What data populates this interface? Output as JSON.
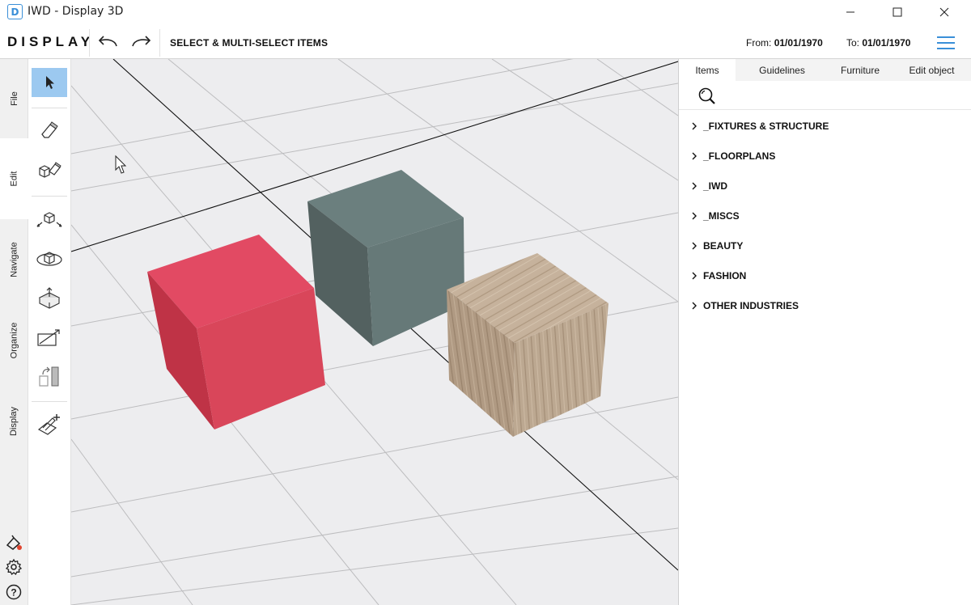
{
  "window": {
    "app_icon_letter": "D",
    "title": "IWD - Display 3D"
  },
  "toolbar": {
    "logo": "DISPLAY",
    "mode_label": "SELECT & MULTI-SELECT ITEMS",
    "from_label": "From:",
    "from_value": "01/01/1970",
    "to_label": "To:",
    "to_value": "01/01/1970"
  },
  "side_tabs": [
    "File",
    "Edit",
    "Navigate",
    "Organize",
    "Display"
  ],
  "tools": [
    {
      "name": "select-arrow-icon",
      "active": true
    },
    {
      "name": "eraser-icon"
    },
    {
      "name": "multi-erase-icon"
    },
    {
      "name": "pan-cube-icon"
    },
    {
      "name": "orbit-cube-icon"
    },
    {
      "name": "lift-cube-icon"
    },
    {
      "name": "resize-frame-icon"
    },
    {
      "name": "align-rotate-icon"
    },
    {
      "name": "add-measure-icon"
    }
  ],
  "viewport": {
    "objects": [
      {
        "name": "red-cube",
        "color": "#e24a63"
      },
      {
        "name": "gray-cube",
        "color": "#667a79"
      },
      {
        "name": "wood-cube",
        "color": "#b9a48e"
      }
    ]
  },
  "panel": {
    "tabs": [
      "Items",
      "Guidelines",
      "Furniture",
      "Edit object"
    ],
    "active_tab": "Items",
    "categories": [
      "_FIXTURES & STRUCTURE",
      "_FLOORPLANS",
      "_IWD",
      "_MISCS",
      "BEAUTY",
      "FASHION",
      "OTHER INDUSTRIES"
    ]
  },
  "colors": {
    "accent": "#3a8fd8",
    "active_tool": "#9cc9f0",
    "viewport_bg": "#ededef"
  }
}
